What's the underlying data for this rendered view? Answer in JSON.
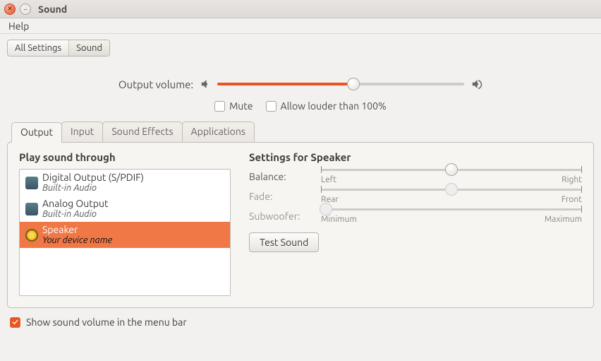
{
  "window": {
    "title": "Sound"
  },
  "menubar": {
    "help": "Help"
  },
  "breadcrumb": {
    "all_settings": "All Settings",
    "sound": "Sound"
  },
  "output_volume": {
    "label": "Output volume:",
    "percent": 55
  },
  "checks": {
    "mute": {
      "label": "Mute",
      "checked": false
    },
    "allow_louder": {
      "label": "Allow louder than 100%",
      "checked": false
    }
  },
  "tabs": {
    "output": "Output",
    "input": "Input",
    "sound_effects": "Sound Effects",
    "applications": "Applications",
    "active": "output"
  },
  "play_through": {
    "title": "Play sound through",
    "devices": [
      {
        "name": "Digital Output (S/PDIF)",
        "sub": "Built-in Audio",
        "icon": "card",
        "selected": false
      },
      {
        "name": "Analog Output",
        "sub": "Built-in Audio",
        "icon": "card",
        "selected": false
      },
      {
        "name": "Speaker",
        "sub": "Your device name",
        "icon": "speaker",
        "selected": true
      }
    ]
  },
  "settings": {
    "title": "Settings for Speaker",
    "balance": {
      "label": "Balance:",
      "percent": 50,
      "left": "Left",
      "right": "Right",
      "enabled": true
    },
    "fade": {
      "label": "Fade:",
      "percent": 50,
      "left": "Rear",
      "right": "Front",
      "enabled": false
    },
    "subwoofer": {
      "label": "Subwoofer:",
      "percent": 2,
      "left": "Minimum",
      "right": "Maximum",
      "enabled": false
    },
    "test_sound": "Test Sound"
  },
  "footer": {
    "show_volume": {
      "label": "Show sound volume in the menu bar",
      "checked": true
    }
  }
}
